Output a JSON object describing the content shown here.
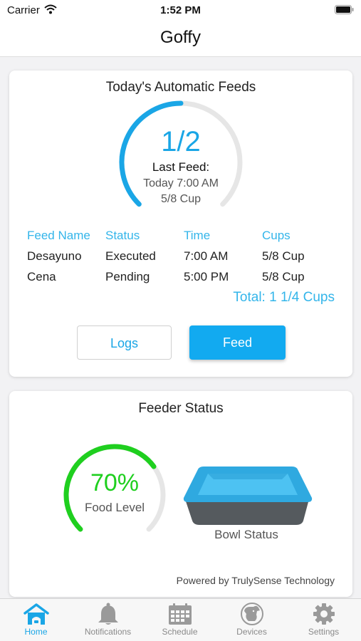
{
  "status_bar": {
    "carrier": "Carrier",
    "time": "1:52 PM"
  },
  "nav": {
    "title": "Goffy"
  },
  "feeds": {
    "title": "Today's Automatic Feeds",
    "count": "1/2",
    "progress_fraction": 0.5,
    "last_feed_label": "Last Feed:",
    "last_feed_time": "Today 7:00 AM",
    "last_feed_amount": "5/8 Cup",
    "headers": [
      "Feed Name",
      "Status",
      "Time",
      "Cups"
    ],
    "rows": [
      [
        "Desayuno",
        "Executed",
        "7:00 AM",
        "5/8 Cup"
      ],
      [
        "Cena",
        "Pending",
        "5:00 PM",
        "5/8 Cup"
      ]
    ],
    "total": "Total: 1 1/4 Cups",
    "logs_label": "Logs",
    "feed_label": "Feed"
  },
  "feeder_status": {
    "title": "Feeder Status",
    "food_level_pct": "70%",
    "food_level_fraction": 0.7,
    "food_level_label": "Food Level",
    "bowl_label": "Bowl Status",
    "powered_by": "Powered by TrulySense Technology"
  },
  "colors": {
    "accent": "#1aa6e6",
    "food_level": "#1fcf1f",
    "track": "#e6e6e6",
    "bowl": "#3db3ea"
  },
  "tabs": [
    {
      "label": "Home",
      "icon": "home-icon",
      "active": true
    },
    {
      "label": "Notifications",
      "icon": "bell-icon",
      "active": false
    },
    {
      "label": "Schedule",
      "icon": "calendar-icon",
      "active": false
    },
    {
      "label": "Devices",
      "icon": "dog-icon",
      "active": false
    },
    {
      "label": "Settings",
      "icon": "gear-icon",
      "active": false
    }
  ]
}
